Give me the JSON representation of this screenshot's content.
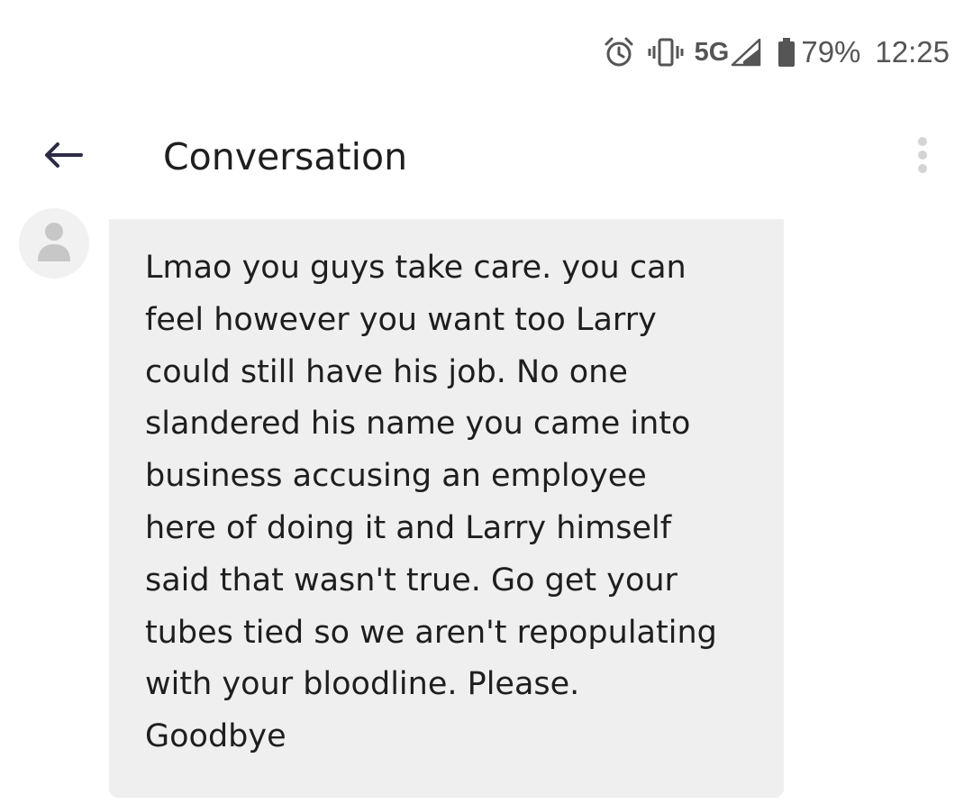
{
  "status_bar": {
    "network": "5G",
    "battery": "79%",
    "time": "12:25",
    "icons": [
      "alarm-icon",
      "vibrate-icon",
      "signal-icon",
      "battery-icon"
    ]
  },
  "app_bar": {
    "title": "Conversation",
    "back_icon": "arrow-left-icon",
    "menu_icon": "more-vertical-icon"
  },
  "message": {
    "avatar_icon": "person-icon",
    "text": "Lmao you guys take care.  you can\nfeel however you want too Larry\ncould still have his job. No one\nslandered his name you came into\nbusiness accusing an employee\nhere of doing it and Larry himself\nsaid that wasn't true. Go get your\ntubes tied so we aren't repopulating\nwith your bloodline.  Please.\nGoodbye"
  },
  "colors": {
    "background": "#ffffff",
    "bubble": "#efefef",
    "text": "#1e1e1e",
    "status_icons": "#555555",
    "back_arrow": "#2b2b45"
  }
}
